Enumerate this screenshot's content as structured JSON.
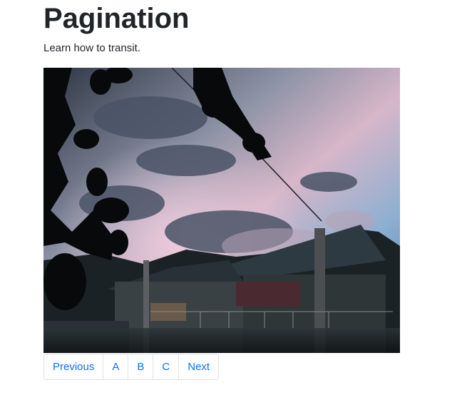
{
  "page": {
    "title": "Pagination",
    "subtitle": "Learn how to transit."
  },
  "photo": {
    "description_icon": "image-photo",
    "colors": {
      "sky_top": "#3a4a63",
      "sky_pink": "#d8b3c8",
      "sky_blue": "#4f86b8",
      "foliage": "#07090b",
      "houses": "#1f272a"
    }
  },
  "pagination": {
    "previous_label": "Previous",
    "pages": [
      "A",
      "B",
      "C"
    ],
    "next_label": "Next",
    "link_color": "#0d6efd",
    "border_color": "#dee2e6"
  }
}
